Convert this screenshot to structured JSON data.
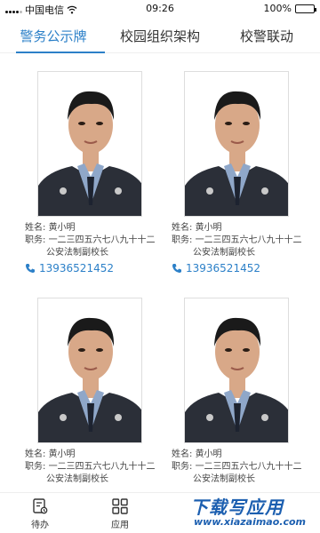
{
  "status_bar": {
    "carrier": "中国电信",
    "time": "09:26",
    "battery": "100%",
    "battery_level": 1.0
  },
  "tabs": [
    {
      "label": "警务公示牌",
      "active": true
    },
    {
      "label": "校园组织架构",
      "active": false
    },
    {
      "label": "校警联动",
      "active": false
    }
  ],
  "cards": [
    {
      "name_label": "姓名:",
      "name": "黄小明",
      "duty_label": "职务:",
      "duty_line1": "一二三四五六七八九十十二",
      "duty_line2": "公安法制副校长",
      "phone": "13936521452"
    },
    {
      "name_label": "姓名:",
      "name": "黄小明",
      "duty_label": "职务:",
      "duty_line1": "一二三四五六七八九十十二",
      "duty_line2": "公安法制副校长",
      "phone": "13936521452"
    },
    {
      "name_label": "姓名:",
      "name": "黄小明",
      "duty_label": "职务:",
      "duty_line1": "一二三四五六七八九十十二",
      "duty_line2": "公安法制副校长",
      "phone": ""
    },
    {
      "name_label": "姓名:",
      "name": "黄小明",
      "duty_label": "职务:",
      "duty_line1": "一二三四五六七八九十十二",
      "duty_line2": "公安法制副校长",
      "phone": ""
    }
  ],
  "bottom_nav": [
    {
      "label": "待办",
      "icon": "todo-icon"
    },
    {
      "label": "应用",
      "icon": "apps-grid-icon"
    }
  ],
  "watermark": {
    "big": "下载写应用",
    "small": "www.xiazaimao.com"
  },
  "colors": {
    "accent": "#2c80c8",
    "uniform": "#2b2f38",
    "shirt": "#8fa7c9",
    "skin": "#d8a888"
  }
}
